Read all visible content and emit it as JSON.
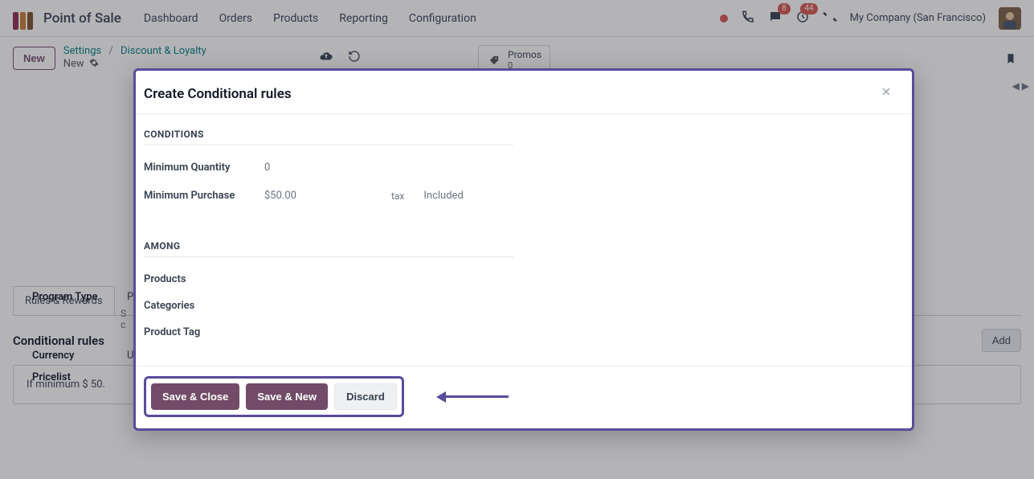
{
  "topbar": {
    "app_name": "Point of Sale",
    "nav": [
      "Dashboard",
      "Orders",
      "Products",
      "Reporting",
      "Configuration"
    ],
    "chat_badge": "8",
    "activity_badge": "44",
    "company": "My Company (San Francisco)"
  },
  "subbar": {
    "new_label": "New",
    "crumb1": "Settings",
    "crumb_sep": "/",
    "crumb2": "Discount & Loyalty",
    "row2": "New",
    "promo_label": "Promos",
    "promo_count": "0"
  },
  "behind": {
    "program_type_label": "Program Type",
    "program_type_value": "P",
    "desc1": "S",
    "desc2": "c",
    "currency_label": "Currency",
    "currency_value": "U",
    "pricelist_label": "Pricelist",
    "tab_label": "Rules & Rewards",
    "section_title": "Conditional rules",
    "add_label": "Add",
    "rule_text": "If minimum $ 50."
  },
  "modal": {
    "title": "Create Conditional rules",
    "conditions_label": "CONDITIONS",
    "min_qty_label": "Minimum Quantity",
    "min_qty_value": "0",
    "min_purchase_label": "Minimum Purchase",
    "min_purchase_value": "$50.00",
    "tax_prefix": "tax",
    "tax_value": "Included",
    "among_label": "AMONG",
    "products_label": "Products",
    "categories_label": "Categories",
    "tag_label": "Product Tag",
    "save_close": "Save & Close",
    "save_new": "Save & New",
    "discard": "Discard"
  }
}
